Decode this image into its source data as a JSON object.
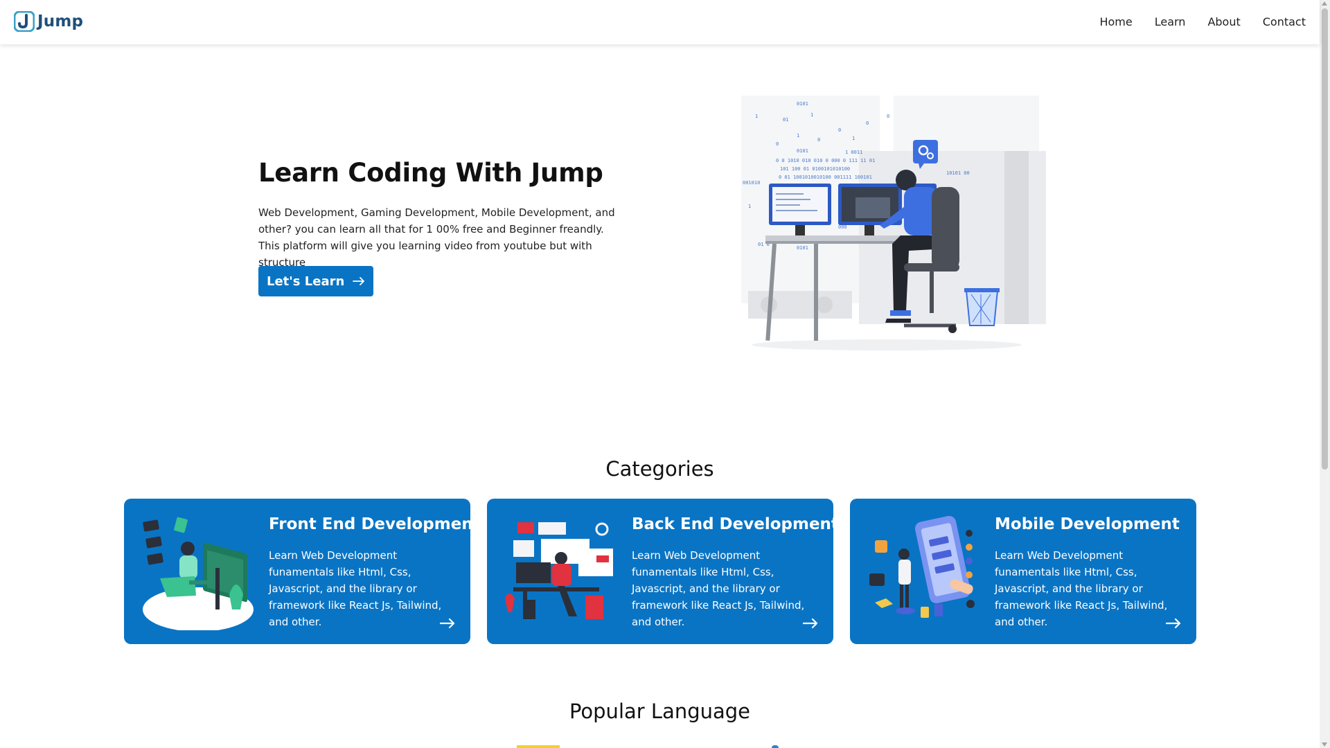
{
  "brand": {
    "name": "Jump",
    "color": "#1f4f7a",
    "logo_icon": "j-logo-icon"
  },
  "nav": {
    "links": [
      {
        "label": "Home"
      },
      {
        "label": "Learn"
      },
      {
        "label": "About"
      },
      {
        "label": "Contact"
      }
    ]
  },
  "hero": {
    "title": "Learn Coding With Jump",
    "description": "Web Development, Gaming Development, Mobile Development, and other? you can learn all that for 1 00% free and Beginner freandly. This platform will give you learning video from youtube but with structure",
    "button_label": "Let's Learn",
    "button_icon": "arrow-right-icon",
    "illustration": "developer-at-desk-illustration"
  },
  "categories": {
    "title": "Categories",
    "items": [
      {
        "title": "Front End Development",
        "description": "Learn Web Development funamentals like Html, Css, Javascript, and the library or framework like React Js, Tailwind, and other.",
        "icon": "frontend-illustration"
      },
      {
        "title": "Back End Development",
        "description": "Learn Web Development funamentals like Html, Css, Javascript, and the library or framework like React Js, Tailwind, and other.",
        "icon": "backend-illustration"
      },
      {
        "title": "Mobile Development",
        "description": "Learn Web Development funamentals like Html, Css, Javascript, and the library or framework like React Js, Tailwind, and other.",
        "icon": "mobile-illustration"
      }
    ]
  },
  "popular": {
    "title": "Popular Language"
  },
  "colors": {
    "primary": "#0a74c4",
    "text": "#111111",
    "card_text": "#ffffff"
  }
}
